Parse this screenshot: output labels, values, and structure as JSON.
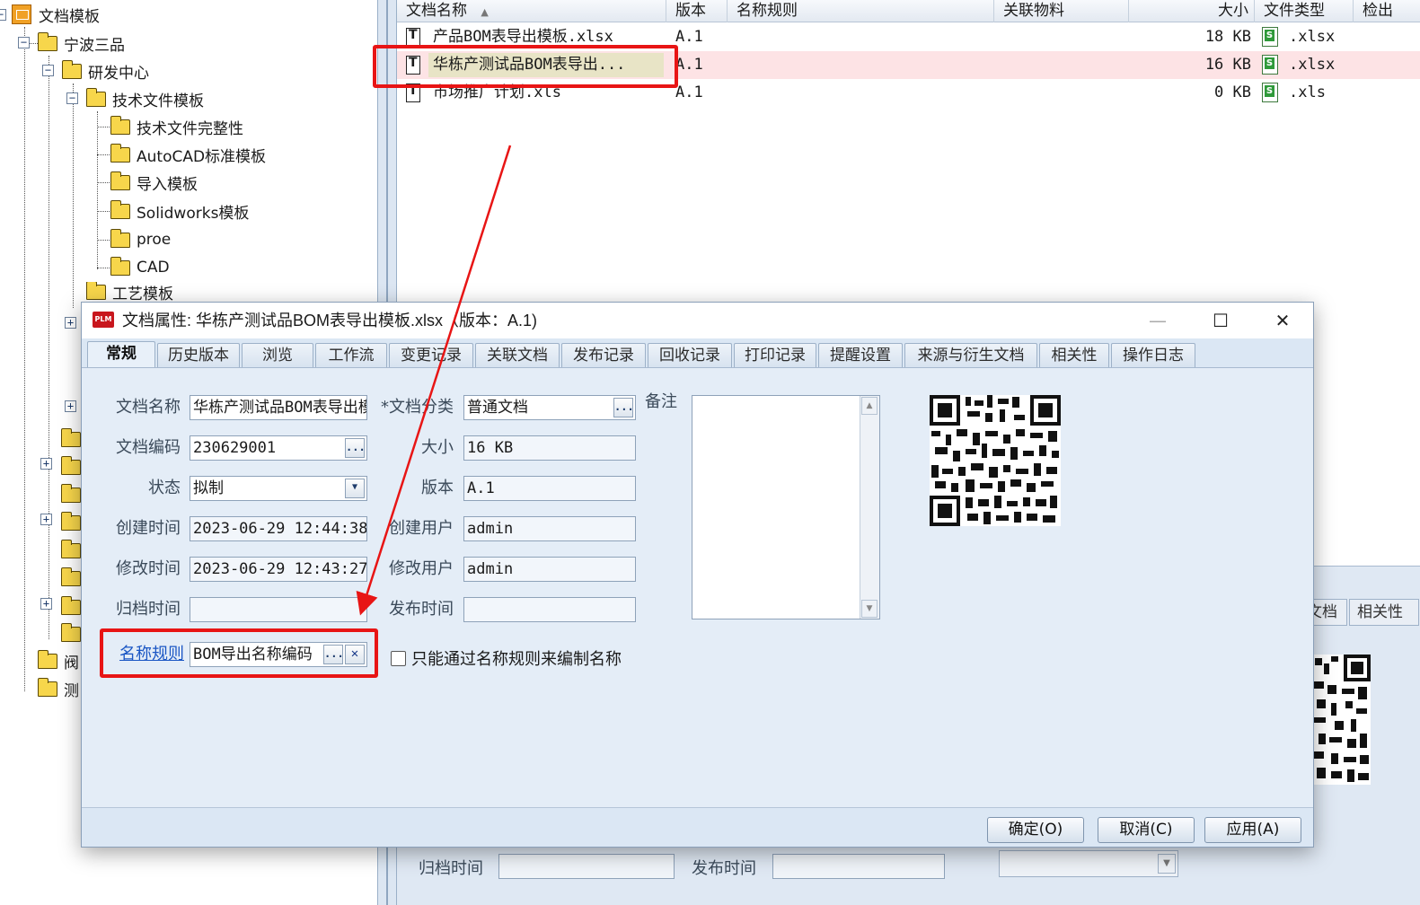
{
  "tree": {
    "root": "文档模板",
    "nodes": [
      {
        "label": "宁波三品"
      },
      {
        "label": "研发中心"
      },
      {
        "label": "技术文件模板"
      },
      {
        "label": "技术文件完整性"
      },
      {
        "label": "AutoCAD标准模板"
      },
      {
        "label": "导入模板"
      },
      {
        "label": "Solidworks模板"
      },
      {
        "label": "proe"
      },
      {
        "label": "CAD"
      },
      {
        "label": "工艺模板"
      }
    ],
    "partial_labels": [
      "阀",
      "测"
    ]
  },
  "filelist": {
    "headers": {
      "name": "文档名称",
      "version": "版本",
      "naming_rule": "名称规则",
      "material": "关联物料",
      "size": "大小",
      "type": "文件类型",
      "checkout": "检出"
    },
    "rows": [
      {
        "name": "产品BOM表导出模板.xlsx",
        "version": "A.1",
        "size": "18 KB",
        "type": ".xlsx"
      },
      {
        "name": "华栋产测试品BOM表导出...",
        "version": "A.1",
        "size": "16 KB",
        "type": ".xlsx"
      },
      {
        "name": "市场推广计划.xls",
        "version": "A.1",
        "size": "0 KB",
        "type": ".xls"
      }
    ]
  },
  "background_panel": {
    "tabs": [
      "文档",
      "相关性"
    ],
    "archive_time_label": "归档时间",
    "publish_time_label": "发布时间"
  },
  "dialog": {
    "title": "文档属性: 华栋产测试品BOM表导出模板.xlsx（版本：A.1)",
    "app_badge": "PLM",
    "tabs": [
      "常规",
      "历史版本",
      "浏览",
      "工作流",
      "变更记录",
      "关联文档",
      "发布记录",
      "回收记录",
      "打印记录",
      "提醒设置",
      "来源与衍生文档",
      "相关性",
      "操作日志"
    ],
    "fields": {
      "doc_name_label": "文档名称",
      "doc_name": "华栋产测试品BOM表导出模板.xlsx",
      "doc_code_label": "文档编码",
      "doc_code": "230629001",
      "status_label": "状态",
      "status": "拟制",
      "created_label": "创建时间",
      "created": "2023-06-29 12:44:38",
      "modified_label": "修改时间",
      "modified": "2023-06-29 12:43:27",
      "archived_label": "归档时间",
      "archived": "",
      "category_label": "*文档分类",
      "category": "普通文档",
      "size_label": "大小",
      "size": "16 KB",
      "version_label": "版本",
      "version": "A.1",
      "creator_label": "创建用户",
      "creator": "admin",
      "modifier_label": "修改用户",
      "modifier": "admin",
      "publish_label": "发布时间",
      "publish": "",
      "remark_label": "备注",
      "naming_rule_label": "名称规则",
      "naming_rule": "BOM导出名称编码",
      "naming_only_label": "只能通过名称规则来编制名称"
    },
    "buttons": {
      "ok": "确定(O)",
      "cancel": "取消(C)",
      "apply": "应用(A)"
    },
    "ellipsis": "...",
    "clear": "✕"
  },
  "colors": {
    "highlight_row": "#fde3e5",
    "annotation_red": "#e81515",
    "dialog_bg": "#e4edf7"
  },
  "icons": [
    "folder-icon",
    "document-icon",
    "excel-icon",
    "qr-code",
    "dropdown-arrow-icon",
    "close-icon",
    "maximize-icon",
    "minimize-icon"
  ]
}
